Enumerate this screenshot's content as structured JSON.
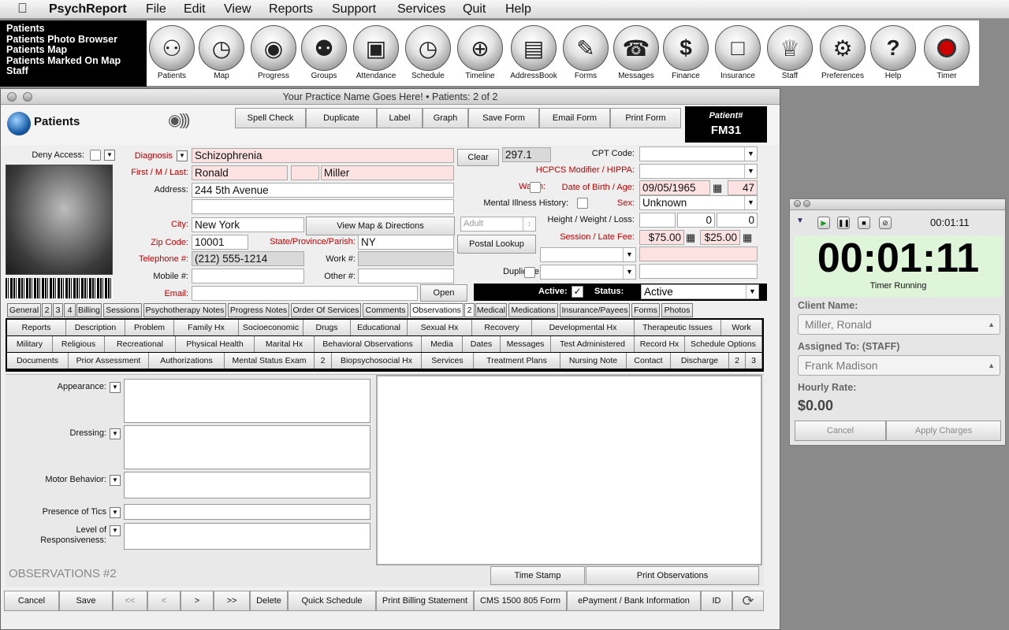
{
  "menubar": {
    "app_name": "PsychReport",
    "items": [
      "File",
      "Edit",
      "View",
      "Reports",
      "Support",
      "Services",
      "Quit",
      "Help"
    ]
  },
  "nav": {
    "items": [
      "Patients",
      "Patients Photo Browser",
      "Patients Map",
      "Patients Marked On Map",
      "Staff"
    ]
  },
  "toolbar": {
    "buttons": [
      {
        "label": "Patients",
        "icon": "people-icon"
      },
      {
        "label": "Map",
        "icon": "globe-icon"
      },
      {
        "label": "Progress",
        "icon": "eye-icon"
      },
      {
        "label": "Groups",
        "icon": "group-icon"
      },
      {
        "label": "Attendance",
        "icon": "clipboard-icon"
      },
      {
        "label": "Schedule",
        "icon": "clock-icon"
      },
      {
        "label": "Timeline",
        "icon": "crosshair-icon"
      },
      {
        "label": "AddressBook",
        "icon": "book-icon"
      },
      {
        "label": "Forms",
        "icon": "pen-icon"
      },
      {
        "label": "Messages",
        "icon": "telephone-icon"
      },
      {
        "label": "Finance",
        "icon": "dollar-icon"
      },
      {
        "label": "Insurance",
        "icon": "folder-icon"
      },
      {
        "label": "Staff",
        "icon": "crown-icon"
      },
      {
        "label": "Preferences",
        "icon": "gears-icon"
      },
      {
        "label": "Help",
        "icon": "question-icon"
      },
      {
        "label": "Timer",
        "icon": "record-icon"
      }
    ]
  },
  "window": {
    "title": "Your Practice Name Goes Here!  •  Patients: 2 of 2"
  },
  "header": {
    "title": "Patients",
    "buttons": [
      "Spell Check",
      "Duplicate",
      "Label",
      "Graph",
      "Save Form",
      "Email Form",
      "Print Form"
    ],
    "patient_label": "Patient#",
    "patient_id": "FM31"
  },
  "form": {
    "deny_access_label": "Deny Access:",
    "diagnosis_label": "Diagnosis",
    "diagnosis": "Schizophrenia",
    "clear_label": "Clear",
    "dx_code": "297.1",
    "cpt_label": "CPT Code:",
    "hcpcs_label": "HCPCS Modifier / HIPPA:",
    "name_label": "First / M / Last:",
    "first": "Ronald",
    "middle": "",
    "last": "Miller",
    "address_label": "Address:",
    "address1": "244 5th Avenue",
    "address2": "",
    "watch_label": "Watch:",
    "dob_label": "Date of Birth / Age:",
    "dob": "09/05/1965",
    "age": "47",
    "mental_label": "Mental Illness History:",
    "sex_label": "Sex:",
    "sex": "Unknown",
    "city_label": "City:",
    "city": "New York",
    "map_btn": "View Map & Directions",
    "age_group": "Adult",
    "hwl_label": "Height / Weight / Loss:",
    "height": "",
    "weight": "0",
    "loss": "0",
    "zip_label": "Zip Code:",
    "zip": "10001",
    "state_label": "State/Province/Parish:",
    "state": "NY",
    "postal_btn": "Postal Lookup",
    "session_label": "Session / Late Fee:",
    "session_fee": "$75.00",
    "late_fee": "$25.00",
    "phone_label": "Telephone #:",
    "phone": "(212) 555-1214",
    "work_label": "Work #:",
    "work": "",
    "mobile_label": "Mobile #:",
    "mobile": "",
    "other_label": "Other #:",
    "other": "",
    "duplicate_label": "Duplicate:",
    "email_label": "Email:",
    "email": "",
    "open_btn": "Open",
    "active_label": "Active:",
    "status_label": "Status:",
    "status": "Active"
  },
  "tabs_row1": [
    "General",
    "2",
    "3",
    "4",
    "Billing",
    "Sessions",
    "Psychotherapy Notes",
    "Progress Notes",
    "Order Of Services",
    "Comments",
    "Observations",
    "2",
    "Medical",
    "Medications",
    "Insurance/Payees",
    "Forms",
    "Photos"
  ],
  "tabs_grid": [
    [
      "Reports",
      "Description",
      "Problem",
      "Family Hx",
      "Socioeconomic",
      "Drugs",
      "Educational",
      "Sexual Hx",
      "Recovery",
      "Developmental Hx",
      "Therapeutic Issues",
      "Work"
    ],
    [
      "Military",
      "Religious",
      "Recreational",
      "Physical Health",
      "Marital Hx",
      "Behavioral Observations",
      "Media",
      "Dates",
      "Messages",
      "Test Administered",
      "Record Hx",
      "Schedule Options"
    ],
    [
      "Documents",
      "Prior Assessment",
      "Authorizations",
      "Mental Status Exam",
      "2",
      "Biopsychosocial Hx",
      "Services",
      "Treatment Plans",
      "Nursing Note",
      "Contact",
      "Discharge",
      "2",
      "3"
    ]
  ],
  "observations": {
    "fields": [
      "Appearance:",
      "Dressing:",
      "Motor Behavior:",
      "Presence of Tics",
      "Level of Responsiveness:"
    ],
    "section_title": "OBSERVATIONS #2",
    "time_stamp": "Time Stamp",
    "print_obs": "Print Observations"
  },
  "bottombar": [
    "Cancel",
    "Save",
    "<<",
    "<",
    ">",
    ">>",
    "Delete",
    "Quick Schedule",
    "Print Billing Statement",
    "CMS 1500 805 Form",
    "ePayment / Bank Information",
    "ID"
  ],
  "timer": {
    "small_time": "00:01:11",
    "big_time": "00:01:11",
    "status": "Timer Running",
    "client_label": "Client Name:",
    "client": "Miller, Ronald",
    "assigned_label": "Assigned To:  (STAFF)",
    "assigned": "Frank Madison",
    "rate_label": "Hourly Rate:",
    "rate": "$0.00",
    "cancel": "Cancel",
    "apply": "Apply Charges"
  }
}
